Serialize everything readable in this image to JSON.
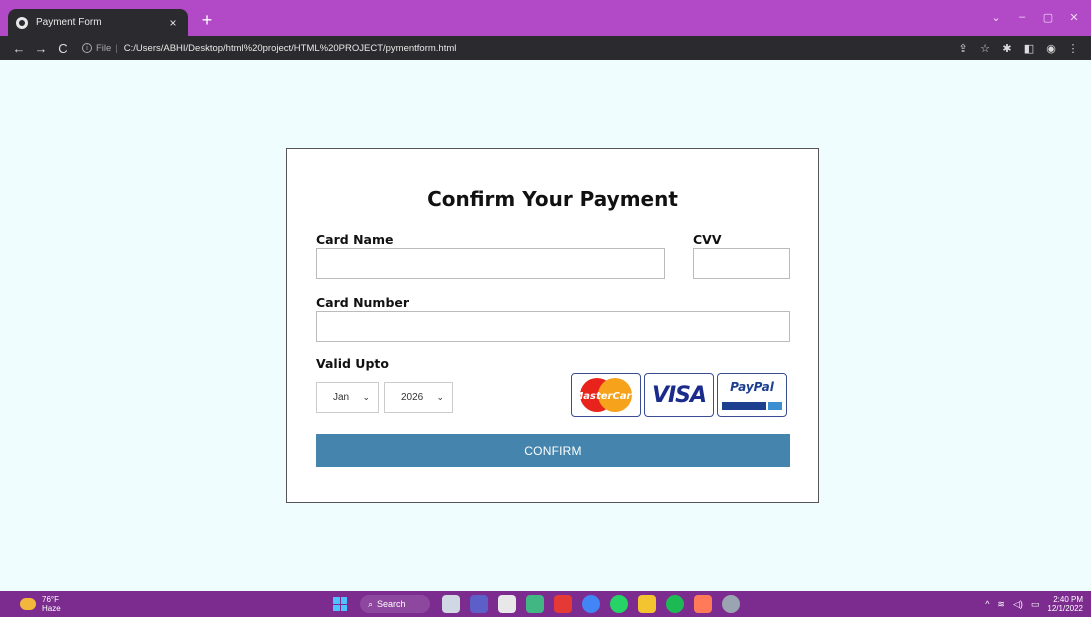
{
  "browser": {
    "tab_title": "Payment Form",
    "tab_close": "×",
    "new_tab": "+",
    "window_controls": [
      "⌄",
      "–",
      "▢",
      "✕"
    ],
    "url_scheme": "File",
    "url": "C:/Users/ABHI/Desktop/html%20project/HTML%20PROJECT/pymentform.html",
    "nav": {
      "back": "←",
      "forward": "→",
      "reload": "C"
    }
  },
  "form": {
    "title": "Confirm Your Payment",
    "card_name_label": "Card Name",
    "cvv_label": "CVV",
    "card_number_label": "Card Number",
    "valid_upto_label": "Valid Upto",
    "month_value": "Jan",
    "year_value": "2026",
    "card_name_value": "",
    "cvv_value": "",
    "card_number_value": "",
    "payment_logos": [
      {
        "name": "mastercard",
        "text": "MasterCard"
      },
      {
        "name": "visa",
        "text": "VISA"
      },
      {
        "name": "paypal",
        "text": "PayPal"
      }
    ],
    "confirm_label": "CONFIRM"
  },
  "colors": {
    "page_bg": "#f0fdfe",
    "button": "#4585ad",
    "tabbar": "#b249c6",
    "taskbar": "#7b2c8e"
  },
  "taskbar": {
    "weather_temp": "76°F",
    "weather_desc": "Haze",
    "search_label": "Search",
    "time": "2:40 PM",
    "date": "12/1/2022"
  }
}
